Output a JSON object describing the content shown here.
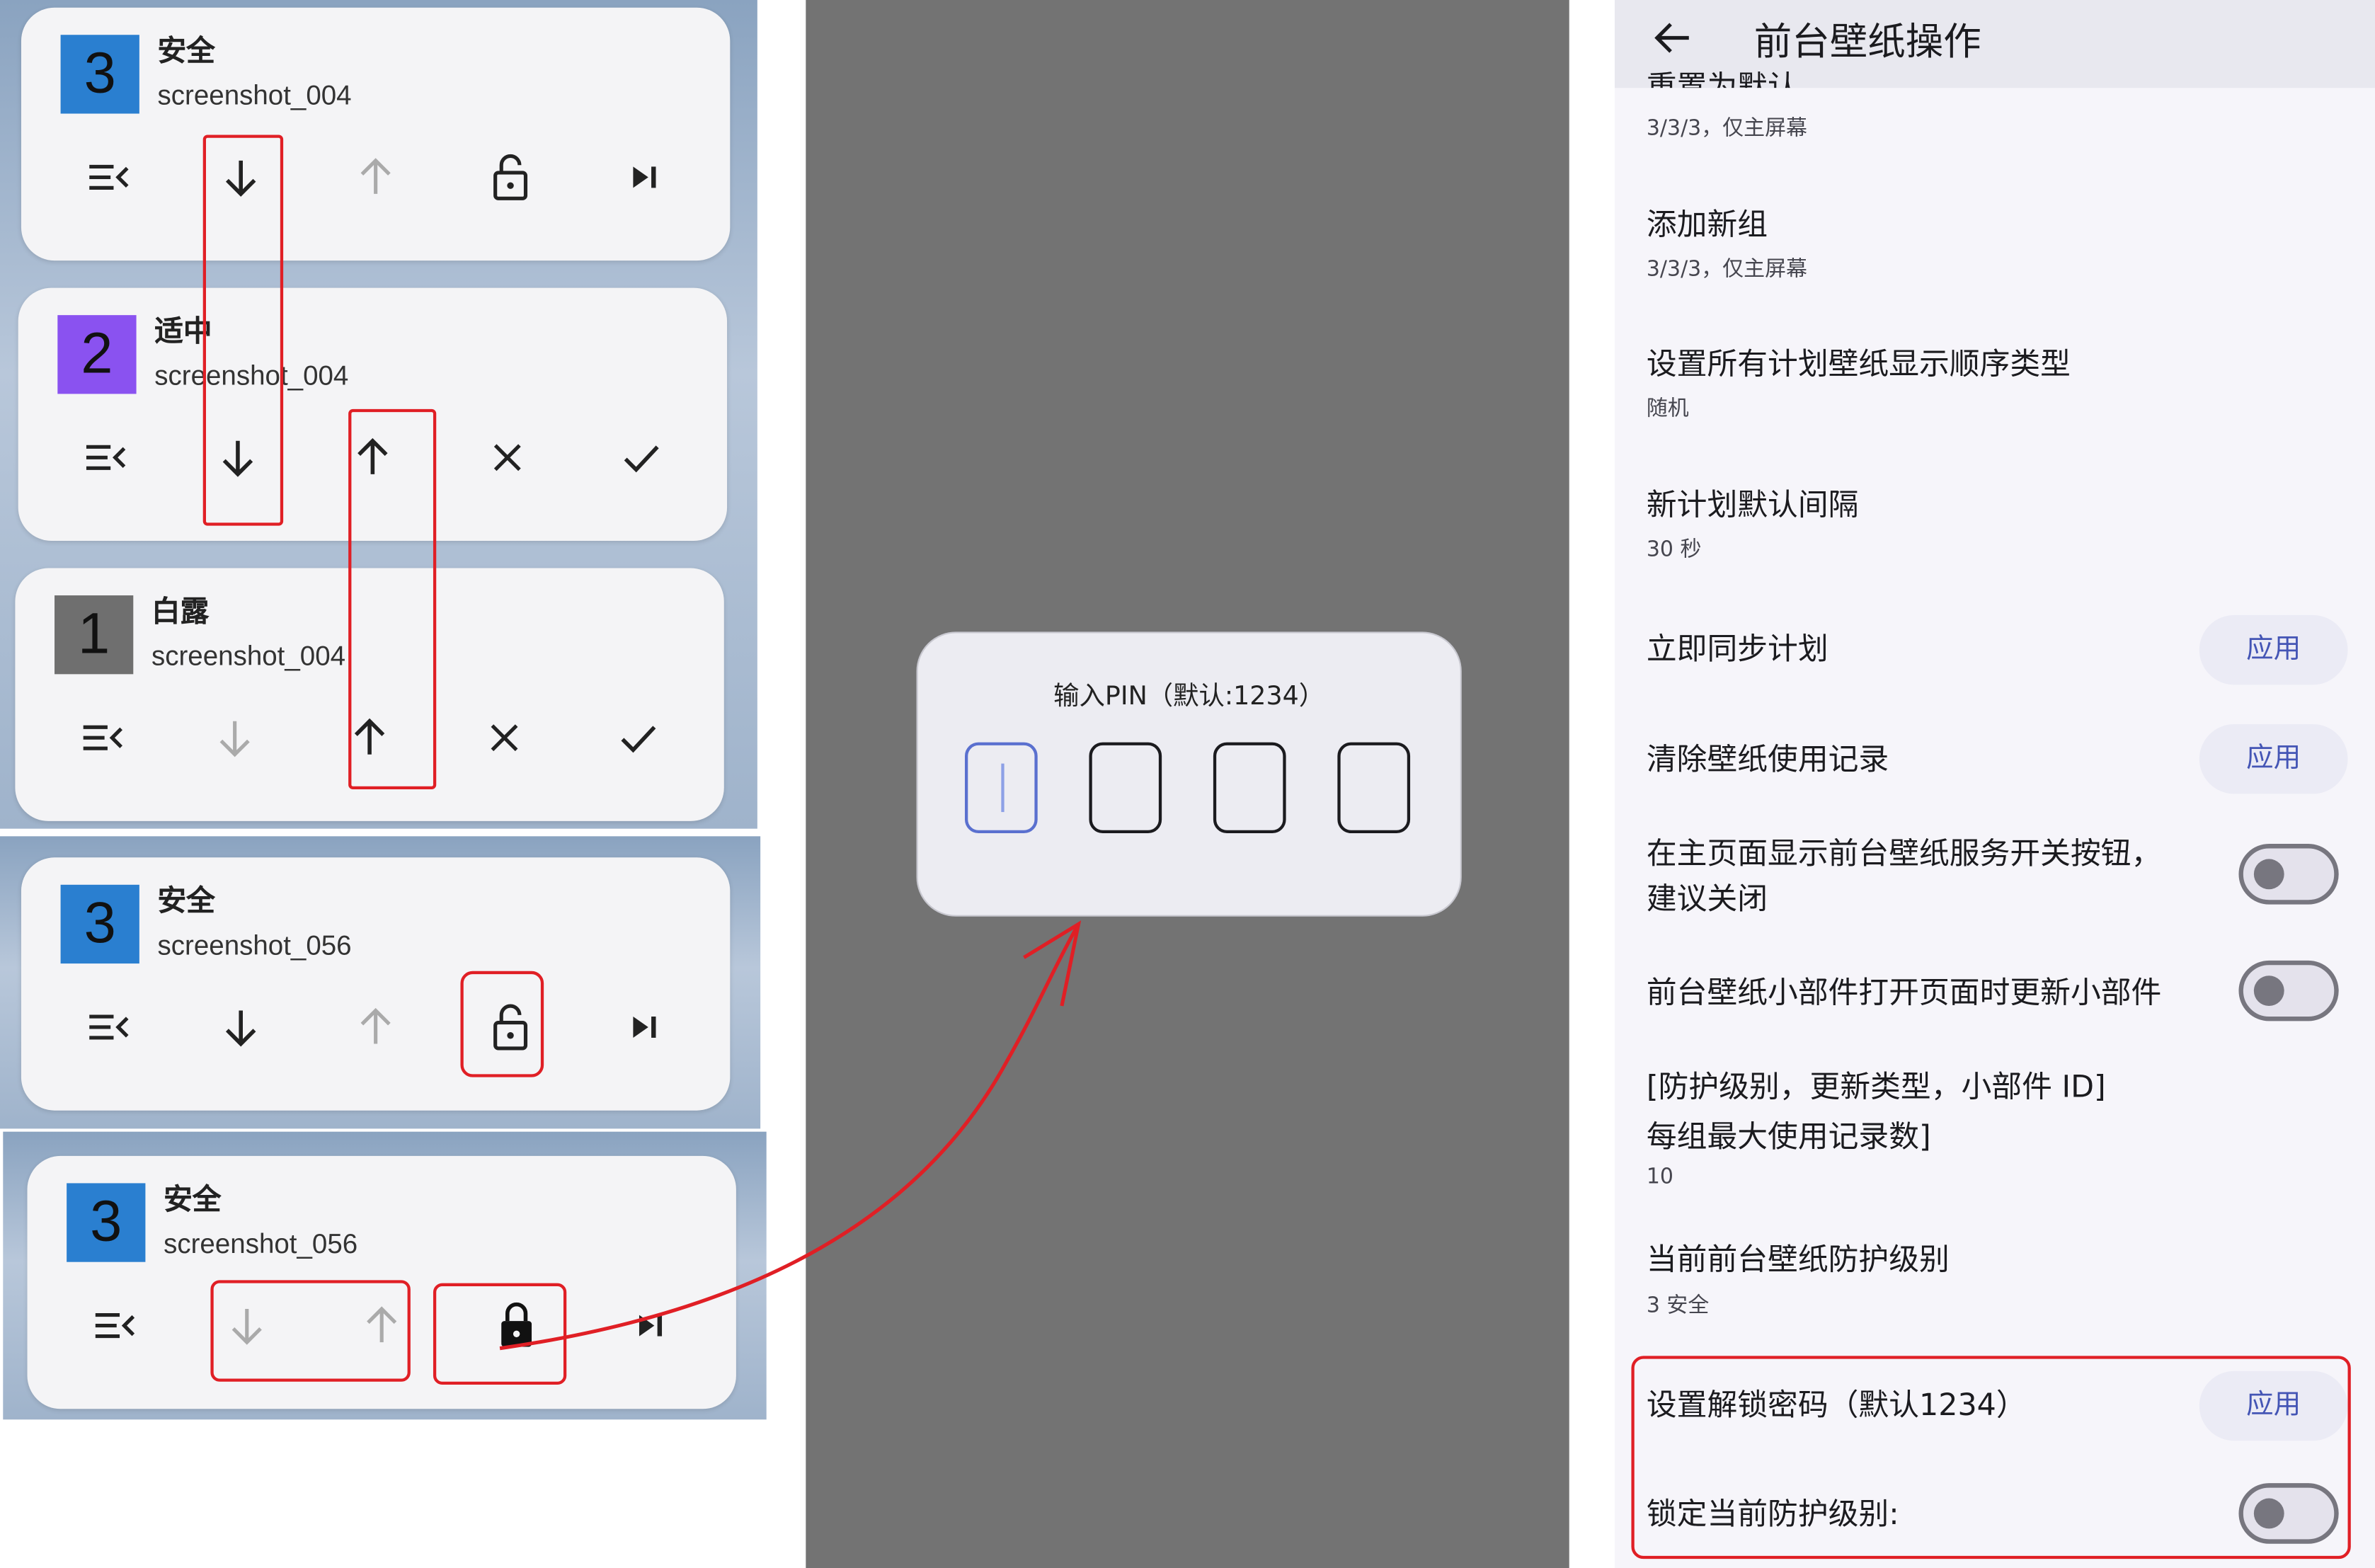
{
  "notifications": [
    {
      "number": "3",
      "color": "#2a7fd0",
      "title": "安全",
      "subtitle": "screenshot_004",
      "actions": [
        "list-icon",
        "arrow-down-icon",
        "arrow-up-icon-dimmed",
        "unlocked-icon",
        "skip-next-icon"
      ]
    },
    {
      "number": "2",
      "color": "#8a52f0",
      "title": "适中",
      "subtitle": "screenshot_004",
      "actions": [
        "list-icon",
        "arrow-down-icon",
        "arrow-up-icon",
        "close-icon",
        "check-icon"
      ]
    },
    {
      "number": "1",
      "color": "#6f6f6f",
      "title": "白露",
      "subtitle": "screenshot_004",
      "actions": [
        "list-icon",
        "arrow-down-icon-dimmed",
        "arrow-up-icon",
        "close-icon",
        "check-icon"
      ]
    },
    {
      "number": "3",
      "color": "#2a7fd0",
      "title": "安全",
      "subtitle": "screenshot_056",
      "actions": [
        "list-icon",
        "arrow-down-icon",
        "arrow-up-icon-dimmed",
        "unlocked-icon",
        "skip-next-icon"
      ]
    },
    {
      "number": "3",
      "color": "#2a7fd0",
      "title": "安全",
      "subtitle": "screenshot_056",
      "actions": [
        "list-icon",
        "arrow-down-icon-dimmed",
        "arrow-up-icon-dimmed",
        "locked-icon",
        "skip-next-icon"
      ]
    }
  ],
  "pin_dialog": {
    "title": "输入PIN（默认:1234）",
    "digits": [
      "",
      "",
      "",
      ""
    ],
    "active_index": 0
  },
  "settings": {
    "header_title": "前台壁纸操作",
    "partial_item_title": "重置为默认",
    "items": [
      {
        "title": "",
        "subtitle": "3/3/3，仅主屏幕"
      },
      {
        "title": "添加新组",
        "subtitle": "3/3/3，仅主屏幕"
      },
      {
        "title": "设置所有计划壁纸显示顺序类型",
        "subtitle": "随机"
      },
      {
        "title": "新计划默认间隔",
        "subtitle": "30 秒"
      },
      {
        "title": "立即同步计划",
        "button": "应用"
      },
      {
        "title": "清除壁纸使用记录",
        "button": "应用"
      },
      {
        "title": "在主页面显示前台壁纸服务开关按钮，",
        "title_line2": "建议关闭",
        "toggle": false
      },
      {
        "title": "前台壁纸小部件打开页面时更新小部件",
        "toggle": false
      },
      {
        "title": "[防护级别，更新类型，小部件 ID]",
        "title_line2": "每组最大使用记录数]",
        "subtitle": "10"
      },
      {
        "title": "当前前台壁纸防护级别",
        "subtitle": "3 安全"
      },
      {
        "title": "设置解锁密码（默认1234）",
        "button": "应用"
      },
      {
        "title": "锁定当前防护级别:",
        "toggle": false
      }
    ]
  },
  "colors": {
    "annotation_red": "#e01f25",
    "accent_blue": "#4455b5",
    "safe_blue": "#2a7fd0",
    "medium_purple": "#8a52f0",
    "bailu_gray": "#6f6f6f"
  }
}
